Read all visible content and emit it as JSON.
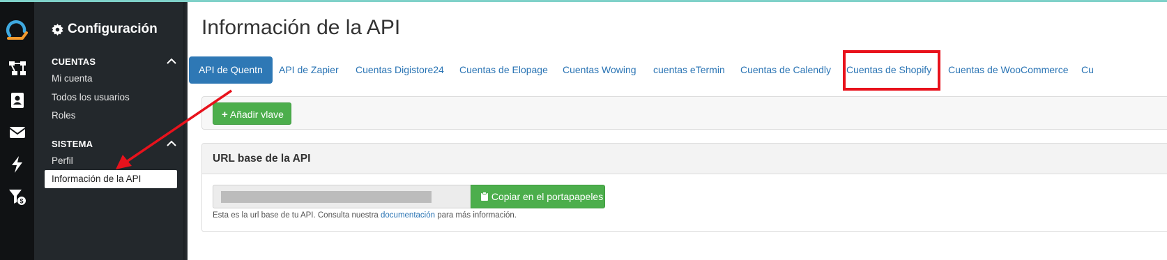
{
  "sidebar": {
    "title": "Configuración",
    "sections": [
      {
        "label": "CUENTAS",
        "items": [
          "Mi cuenta",
          "Todos los usuarios",
          "Roles"
        ]
      },
      {
        "label": "SISTEMA",
        "items": [
          "Perfil",
          "Información de la API"
        ]
      }
    ],
    "active_item": "Información de la API"
  },
  "rail_icons": [
    "logo-icon",
    "hierarchy-icon",
    "contacts-icon",
    "mail-icon",
    "bolt-icon",
    "funnel-dollar-icon"
  ],
  "main": {
    "title": "Información de la API",
    "tabs": [
      "API de Quentn",
      "API de Zapier",
      "Cuentas Digistore24",
      "Cuentas de Elopage",
      "Cuentas Wowing",
      "cuentas eTermin",
      "Cuentas de Calendly",
      "Cuentas de Shopify",
      "Cuentas de WooCommerce",
      "Cu"
    ],
    "active_tab": "API de Quentn",
    "highlighted_tab": "Cuentas de Shopify",
    "add_key_button": "Añadir vlave",
    "base_url_panel": {
      "heading": "URL base de la API",
      "copy_button": "Copiar en el portapapeles",
      "help_prefix": "Esta es la url base de tu API. Consulta nuestra ",
      "help_link": "documentación",
      "help_suffix": " para más información."
    }
  },
  "colors": {
    "rail": "#101214",
    "sidebar": "#23282c",
    "accent": "#2e78b5",
    "success": "#4cae4c",
    "annotation": "#e8121c"
  }
}
